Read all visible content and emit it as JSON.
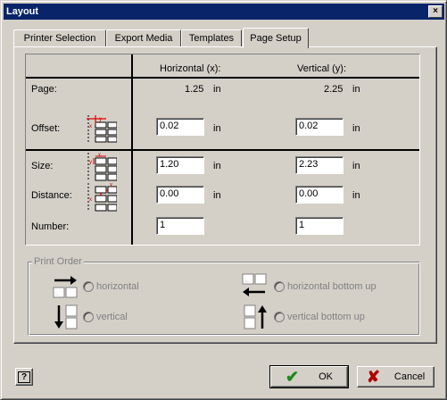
{
  "window": {
    "title": "Layout",
    "close_glyph": "×"
  },
  "tabs": [
    {
      "label": "Printer Selection",
      "active": false
    },
    {
      "label": "Export Media",
      "active": false
    },
    {
      "label": "Templates",
      "active": false
    },
    {
      "label": "Page Setup",
      "active": true
    }
  ],
  "grid": {
    "col_horizontal": "Horizontal (x):",
    "col_vertical": "Vertical (y):",
    "rows": {
      "page": {
        "label": "Page:",
        "x": "1.25",
        "y": "2.25",
        "unit": "in"
      },
      "offset": {
        "label": "Offset:",
        "x": "0.02",
        "y": "0.02",
        "unit": "in",
        "icon": "offset-diagram-icon"
      },
      "size": {
        "label": "Size:",
        "x": "1.20",
        "y": "2.23",
        "unit": "in",
        "icon": "size-diagram-icon"
      },
      "distance": {
        "label": "Distance:",
        "x": "0.00",
        "y": "0.00",
        "unit": "in",
        "icon": "distance-diagram-icon"
      },
      "number": {
        "label": "Number:",
        "x": "1",
        "y": "1"
      }
    }
  },
  "print_order": {
    "label": "Print Order",
    "options": [
      {
        "label": "horizontal",
        "icon": "horizontal-order-icon"
      },
      {
        "label": "horizontal bottom up",
        "icon": "horizontal-bottom-up-order-icon"
      },
      {
        "label": "vertical",
        "icon": "vertical-order-icon"
      },
      {
        "label": "vertical bottom up",
        "icon": "vertical-bottom-up-order-icon"
      }
    ]
  },
  "buttons": {
    "help_glyph": "?",
    "ok_label": "OK",
    "ok_glyph": "✔",
    "cancel_label": "Cancel",
    "cancel_glyph": "✘"
  },
  "colors": {
    "titlebar": "#0a246a",
    "face": "#d4d0c8",
    "ok_check": "#1a8a1a",
    "cancel_x": "#b00000"
  }
}
